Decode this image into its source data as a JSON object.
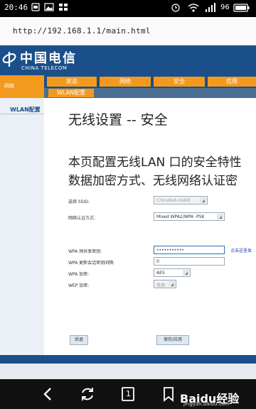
{
  "status_bar": {
    "time": "20:46"
  },
  "browser": {
    "url": "http://192.168.1.1/main.html"
  },
  "brand": {
    "name_cn": "中国电信",
    "name_en": "CHINA TELECOM"
  },
  "sidebar": {
    "top_label": "网络",
    "items": [
      {
        "label": "WLAN配置"
      }
    ]
  },
  "nav": {
    "tabs": [
      {
        "label": "状态"
      },
      {
        "label": "网络"
      },
      {
        "label": "安全"
      },
      {
        "label": "应用"
      }
    ],
    "subtab": "WLAN配置"
  },
  "main": {
    "title": "无线设置 -- 安全",
    "description_line1": "本页配置无线LAN 口的安全特性",
    "description_line2": "数据加密方式、无线网络认证密"
  },
  "form": {
    "ssid_label": "选择 SSID:",
    "ssid_value": "ChinaNet-xlabIE",
    "auth_label": "网络认证方式:",
    "auth_value": "Mixed WPA2/WPA -PSK",
    "psk_label": "WPA 预共享密钥:",
    "psk_value": "•••••••••••",
    "psk_link": "点击这里显",
    "rekey_label": "WPA 更新会话密钥间隔:",
    "rekey_value": "0",
    "enc_label": "WPA 加密:",
    "enc_value": "AES",
    "wep_label": "WEP 加密:",
    "wep_value": "禁用"
  },
  "buttons": {
    "back": "后退",
    "save": "保存/应用"
  },
  "watermark": {
    "text": "Baidu经验",
    "sub": "jingyan.baidu.com"
  },
  "toolbar": {
    "tab_count": "1"
  },
  "colors": {
    "brand_blue": "#1b4f8a",
    "accent_orange": "#f39a1e"
  }
}
